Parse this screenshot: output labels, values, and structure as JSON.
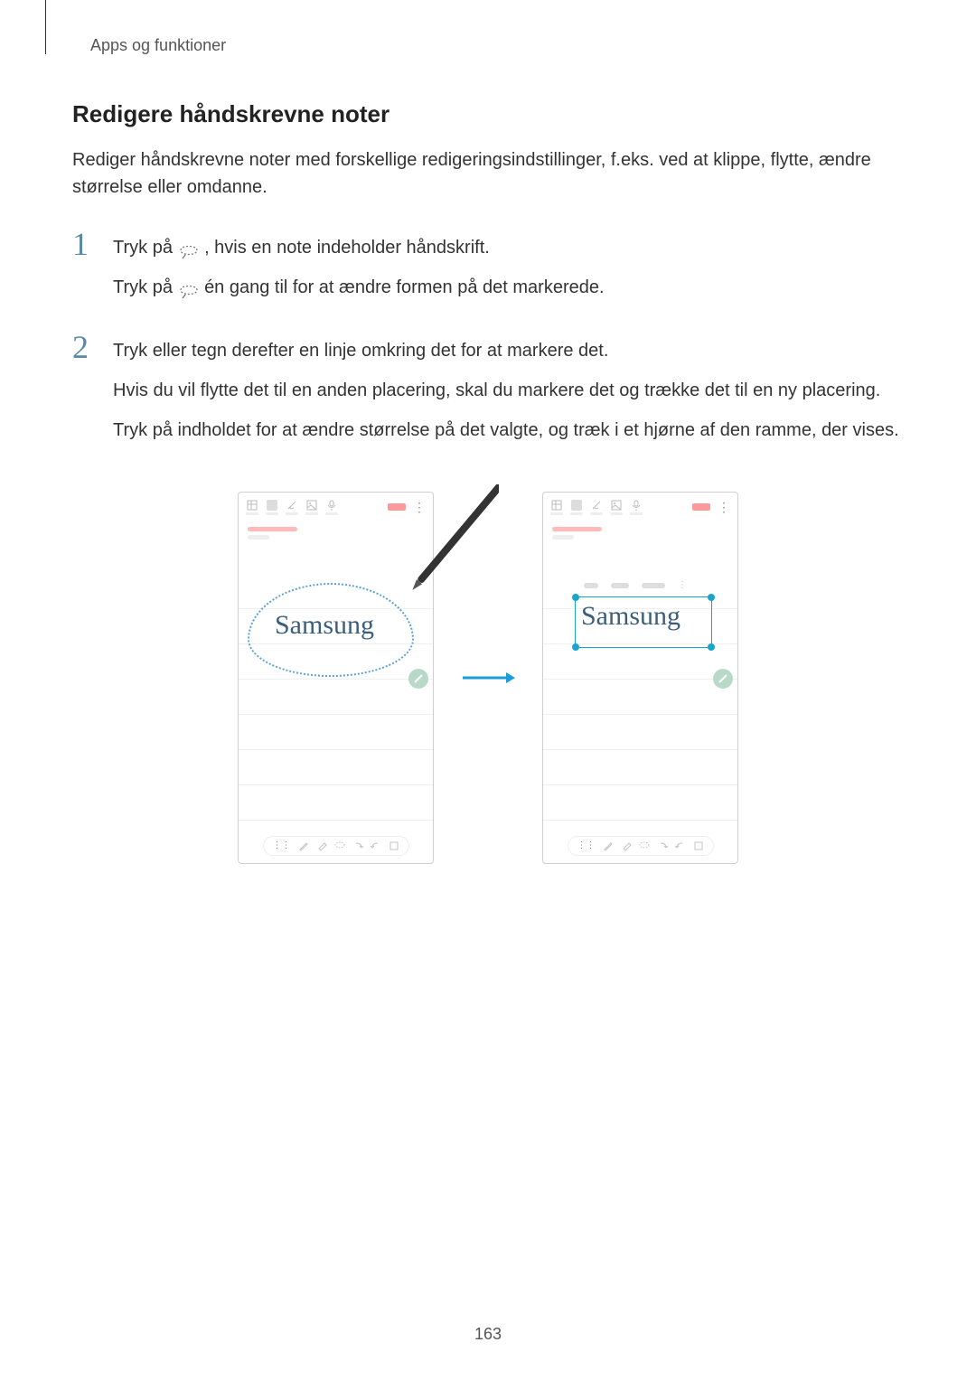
{
  "breadcrumb": "Apps og funktioner",
  "heading": "Redigere håndskrevne noter",
  "intro": "Rediger håndskrevne noter med forskellige redigeringsindstillinger, f.eks. ved at klippe, flytte, ændre størrelse eller omdanne.",
  "steps": {
    "s1": {
      "num": "1",
      "l1a": "Tryk på ",
      "l1b": ", hvis en note indeholder håndskrift.",
      "l2a": "Tryk på ",
      "l2b": " én gang til for at ændre formen på det markerede."
    },
    "s2": {
      "num": "2",
      "l1": "Tryk eller tegn derefter en linje omkring det for at markere det.",
      "l2": "Hvis du vil flytte det til en anden placering, skal du markere det og trække det til en ny placering.",
      "l3": "Tryk på indholdet for at ændre størrelse på det valgte, og træk i et hjørne af den ramme, der vises."
    }
  },
  "illustration": {
    "handwriting": "Samsung"
  },
  "page_number": "163"
}
